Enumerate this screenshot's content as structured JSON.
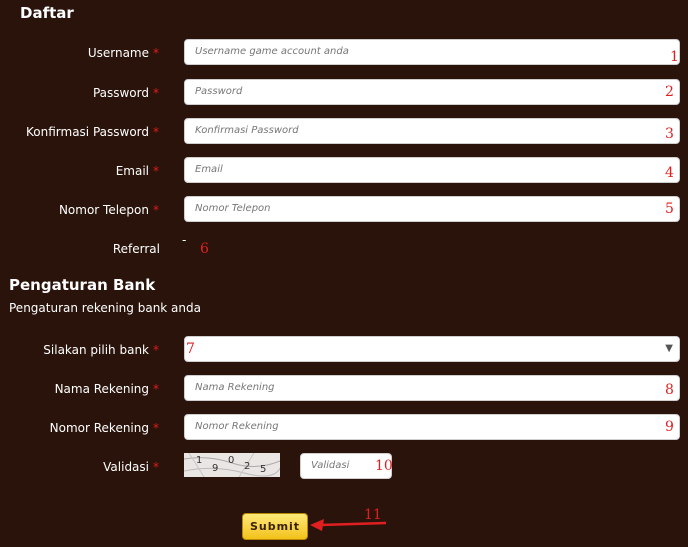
{
  "form": {
    "title": "Daftar",
    "required_mark": "*",
    "fields": [
      {
        "label": "Username",
        "placeholder": "Username game account anda",
        "marker": "1"
      },
      {
        "label": "Password",
        "placeholder": "Password",
        "marker": "2"
      },
      {
        "label": "Konfirmasi Password",
        "placeholder": "Konfirmasi Password",
        "marker": "3"
      },
      {
        "label": "Email",
        "placeholder": "Email",
        "marker": "4"
      },
      {
        "label": "Nomor Telepon",
        "placeholder": "Nomor Telepon",
        "marker": "5"
      }
    ],
    "referral": {
      "label": "Referral",
      "value": "-",
      "marker": "6"
    }
  },
  "bank": {
    "title": "Pengaturan Bank",
    "subtitle": "Pengaturan rekening bank anda",
    "select": {
      "label": "Silakan pilih bank",
      "marker": "7",
      "caret_icon": "chevron-down-icon"
    },
    "fields": [
      {
        "label": "Nama Rekening",
        "placeholder": "Nama Rekening",
        "marker": "8"
      },
      {
        "label": "Nomor Rekening",
        "placeholder": "Nomor Rekening",
        "marker": "9"
      }
    ],
    "validation": {
      "label": "Validasi",
      "captcha_digits": [
        "1",
        "9",
        "0",
        "2",
        "5"
      ],
      "placeholder": "Validasi",
      "marker": "10"
    }
  },
  "submit": {
    "label": "Submit",
    "marker": "11"
  },
  "colors": {
    "background": "#2a130b",
    "required": "#e11b1b",
    "marker": "#e02020",
    "button": "#f2c21a"
  }
}
